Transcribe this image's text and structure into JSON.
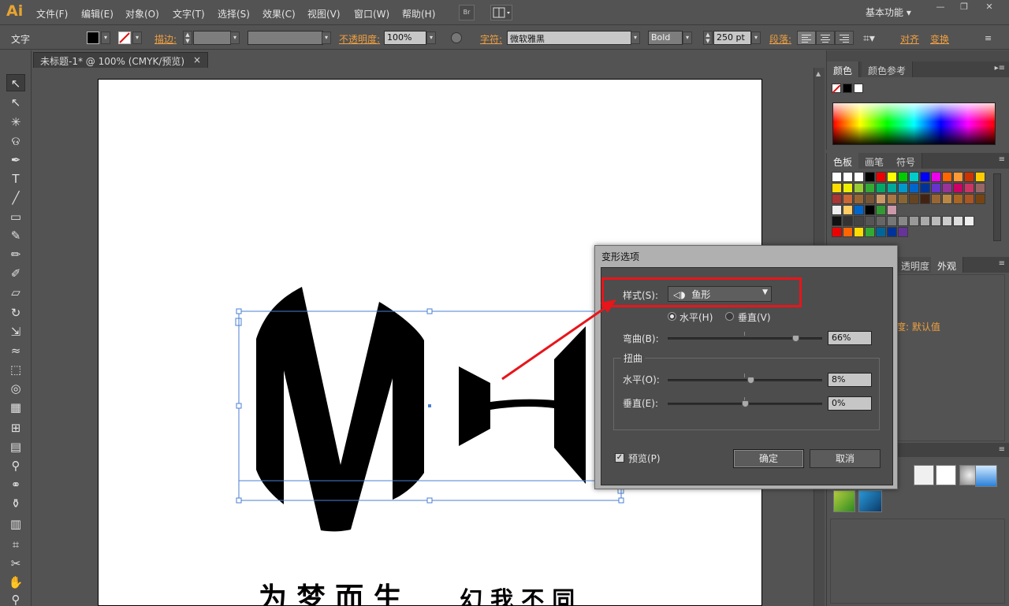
{
  "app": {
    "logo": "Ai"
  },
  "menu": [
    "文件(F)",
    "编辑(E)",
    "对象(O)",
    "文字(T)",
    "选择(S)",
    "效果(C)",
    "视图(V)",
    "窗口(W)",
    "帮助(H)"
  ],
  "menu_bridge": "Br",
  "workspace": "基本功能",
  "control": {
    "tool_label": "文字",
    "stroke_label": "描边:",
    "opacity_label": "不透明度:",
    "opacity_value": "100%",
    "char_label": "字符:",
    "font_family": "微软雅黑",
    "font_style": "Bold",
    "font_size": "250 pt",
    "paragraph_label": "段落:",
    "align_label": "对齐",
    "transform_label": "变换"
  },
  "document": {
    "tab_title": "未标题-1* @ 100% (CMYK/预览)",
    "close": "×"
  },
  "artwork": {
    "tagline_a": "为 梦 而 生",
    "tagline_b": "幻 我 不 同"
  },
  "panels": {
    "color_tabs": [
      "颜色",
      "颜色参考"
    ],
    "swatch_tabs": [
      "色板",
      "画笔",
      "符号"
    ],
    "appearance_tabs": [
      "透明度",
      "外观"
    ],
    "appearance_row": "度: 默认值"
  },
  "dialog": {
    "title": "变形选项",
    "style_label": "样式(S):",
    "style_value": "鱼形",
    "horizontal": "水平(H)",
    "vertical": "垂直(V)",
    "bend_label": "弯曲(B):",
    "bend_value": "66%",
    "distort_group": "扭曲",
    "distort_h_label": "水平(O):",
    "distort_h_value": "8%",
    "distort_v_label": "垂直(E):",
    "distort_v_value": "0%",
    "preview_label": "预览(P)",
    "ok": "确定",
    "cancel": "取消",
    "bend_level": 0.83,
    "distort_h_level": 0.54,
    "distort_v_level": 0.5,
    "orientation_selected": "horizontal",
    "preview_checked": true
  },
  "colors": {
    "accent_orange": "#f0a040",
    "highlight_red": "#e8151a",
    "logo": "#e8a430"
  }
}
